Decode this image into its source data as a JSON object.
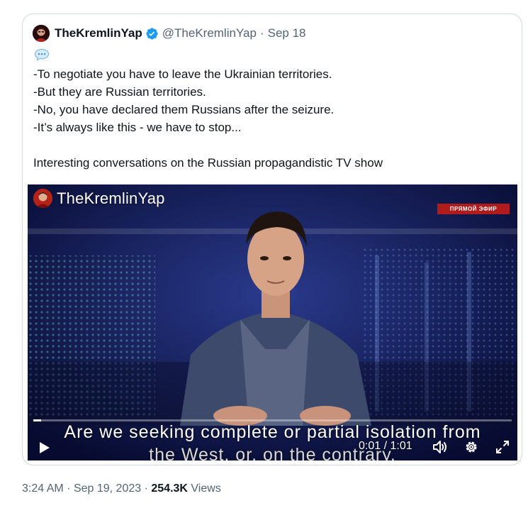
{
  "quoted_tweet": {
    "display_name": "TheKremlinYap",
    "handle": "@TheKremlinYap",
    "separator": "·",
    "date": "Sep 18",
    "lines": [
      "-To negotiate you have to leave the Ukrainian territories.",
      "-But they are Russian territories.",
      "-No, you have declared them Russians after the seizure.",
      "-It’s always like this - we have to stop..."
    ],
    "caption": "Interesting conversations on the Russian propagandistic TV show"
  },
  "video": {
    "watermark": "TheKremlinYap",
    "live_badge": "ПРЯМОЙ ЭФИР",
    "subtitle_line1": "Are we seeking complete or partial isolation from",
    "subtitle_line2": "the West, or, on the contrary,",
    "time_display": "0:01 / 1:01",
    "progress_fraction": 0.016,
    "icons": [
      "play-icon",
      "volume-icon",
      "settings-gear-icon",
      "fullscreen-icon"
    ]
  },
  "footer": {
    "time": "3:24 AM",
    "separator": "·",
    "date": "Sep 19, 2023",
    "views_count": "254.3K",
    "views_label": "Views"
  },
  "colors": {
    "verified_blue": "#1d9bf0",
    "muted_text": "#536471",
    "card_border": "#cfd9de"
  }
}
